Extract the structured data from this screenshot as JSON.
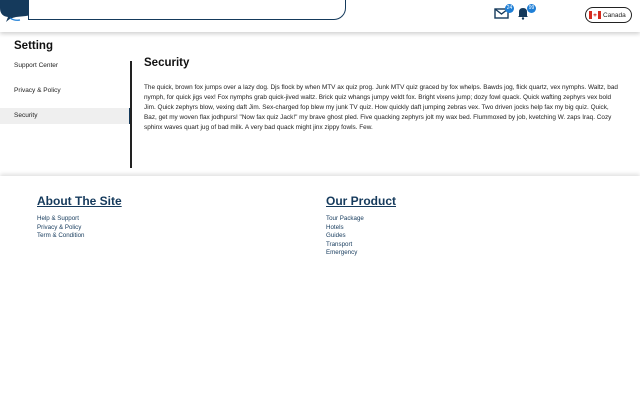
{
  "header": {
    "search_placeholder": "",
    "mail_badge": "24",
    "notification_badge": "99",
    "country": "Canada"
  },
  "settings": {
    "title": "Setting",
    "menu": [
      {
        "label": "Support Center"
      },
      {
        "label": "Privacy & Policy"
      },
      {
        "label": "Security"
      }
    ],
    "active_index": 2
  },
  "content": {
    "title": "Security",
    "body": "The quick, brown fox jumps over a lazy dog. Djs flock by when MTV ax quiz prog. Junk MTV quiz graced by fox whelps. Bawds jog, flick quartz, vex nymphs. Waltz, bad nymph, for quick jigs vex! Fox nymphs grab quick-jived waltz. Brick quiz whangs jumpy veldt fox. Bright vixens jump; dozy fowl quack. Quick wafting zephyrs vex bold Jim. Quick zephyrs blow, vexing daft Jim. Sex-charged fop blew my junk TV quiz. How quickly daft jumping zebras vex. Two driven jocks help fax my big quiz. Quick, Baz, get my woven flax jodhpurs! \"Now fax quiz Jack!\" my brave ghost pled. Five quacking zephyrs jolt my wax bed. Flummoxed by job, kvetching W. zaps Iraq. Cozy sphinx waves quart jug of bad milk. A very bad quack might jinx zippy fowls. Few."
  },
  "footer": {
    "about": {
      "heading": "About The Site",
      "links": [
        "Help & Support",
        "Privacy & Policy",
        "Term & Condition"
      ]
    },
    "product": {
      "heading": "Our Product",
      "links": [
        "Tour Package",
        "Hotels",
        "Guides",
        "Transport",
        "Emergency"
      ]
    }
  },
  "colors": {
    "primary": "#153a5c",
    "accent_badge": "#1f7fd6",
    "active_bg": "#efefef"
  }
}
